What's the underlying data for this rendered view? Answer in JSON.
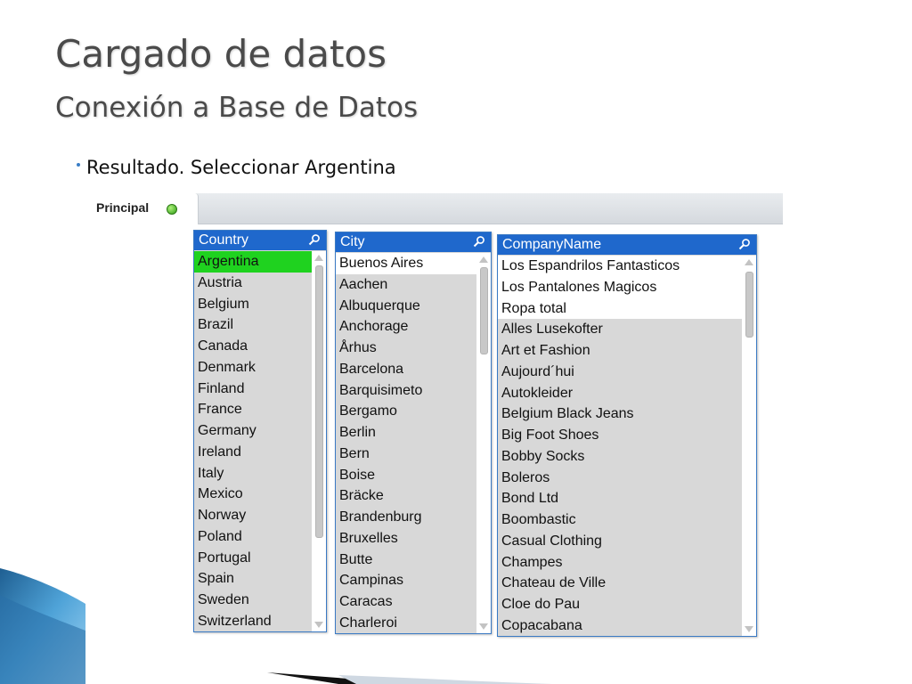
{
  "slide": {
    "title": "Cargado de datos",
    "subtitle": "Conexión a Base de Datos",
    "bullet": "Resultado. Seleccionar Argentina"
  },
  "app": {
    "tab_label": "Principal",
    "colors": {
      "header": "#1f68cc",
      "selected": "#1fd21f",
      "possible": "#ffffff",
      "excluded": "#d8d8d8",
      "status": "#2c9a14"
    },
    "listboxes": {
      "country": {
        "title": "Country",
        "search_icon": "search-icon",
        "items": [
          "Argentina",
          "Austria",
          "Belgium",
          "Brazil",
          "Canada",
          "Denmark",
          "Finland",
          "France",
          "Germany",
          "Ireland",
          "Italy",
          "Mexico",
          "Norway",
          "Poland",
          "Portugal",
          "Spain",
          "Sweden",
          "Switzerland"
        ],
        "selected": [
          "Argentina"
        ],
        "possible": []
      },
      "city": {
        "title": "City",
        "search_icon": "search-icon",
        "items": [
          "Buenos Aires",
          "Aachen",
          "Albuquerque",
          "Anchorage",
          "Århus",
          "Barcelona",
          "Barquisimeto",
          "Bergamo",
          "Berlin",
          "Bern",
          "Boise",
          "Bräcke",
          "Brandenburg",
          "Bruxelles",
          "Butte",
          "Campinas",
          "Caracas",
          "Charleroi"
        ],
        "selected": [],
        "possible": [
          "Buenos Aires"
        ]
      },
      "company": {
        "title": "CompanyName",
        "search_icon": "search-icon",
        "items": [
          "Los Espandrilos Fantasticos",
          "Los Pantalones Magicos",
          "Ropa total",
          "Alles Lusekofter",
          "Art et Fashion",
          "Aujourd´hui",
          "Autokleider",
          "Belgium Black Jeans",
          "Big Foot Shoes",
          "Bobby Socks",
          "Boleros",
          "Bond Ltd",
          "Boombastic",
          "Casual Clothing",
          "Champes",
          "Chateau de Ville",
          "Cloe do Pau",
          "Copacabana"
        ],
        "selected": [],
        "possible": [
          "Los Espandrilos Fantasticos",
          "Los Pantalones Magicos",
          "Ropa total"
        ]
      }
    }
  }
}
